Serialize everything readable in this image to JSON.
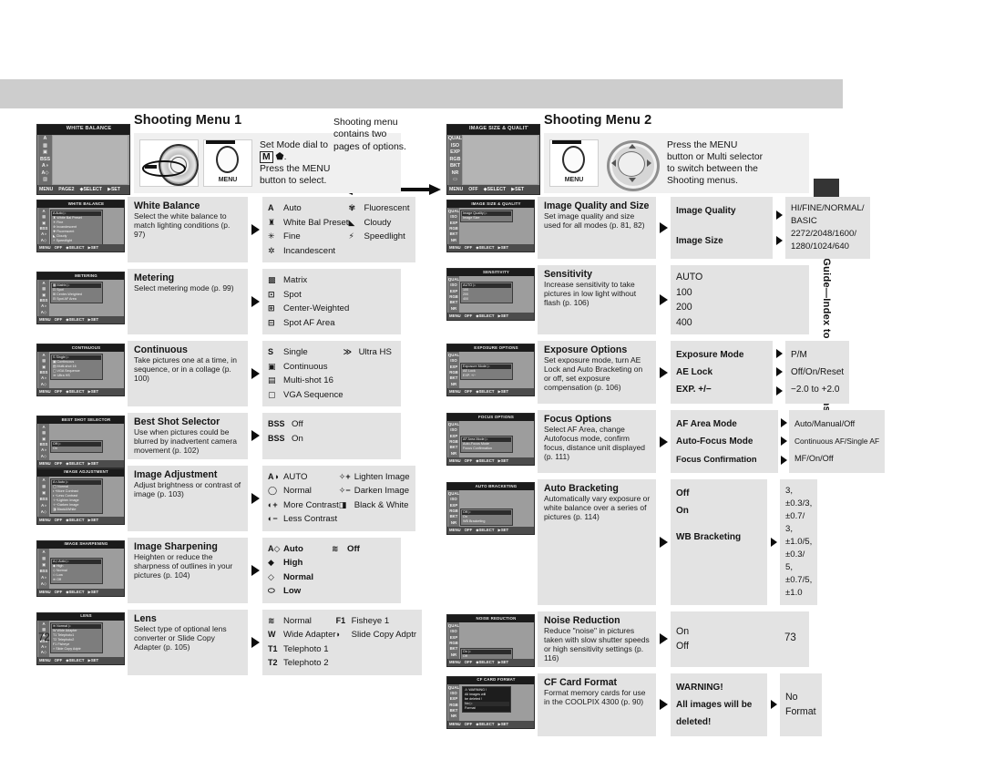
{
  "document": {
    "running_tab": "Menu Guide—Index to Menu Options",
    "page_left": "72",
    "page_right": "73"
  },
  "left_page": {
    "title": "Shooting Menu 1",
    "lcd": {
      "title": "WHITE BALANCE",
      "rail": [
        "A",
        "▩",
        "▣",
        "BSS",
        "A◑",
        "A◇",
        "▨"
      ],
      "page_marks": [
        "1",
        "2"
      ],
      "footer": [
        "MENU",
        "PAGE2",
        "◆SELECT",
        "▶ SET"
      ]
    },
    "instruction": {
      "line1": "Set Mode dial to",
      "line2": "M",
      "line3": ".",
      "line4": "Press the MENU",
      "line5": "button to select.",
      "menu_button_label": "MENU"
    },
    "side_note": "Shooting menu contains two pages of options.",
    "entries": [
      {
        "lcd_title": "WHITE BALANCE",
        "lcd_items": [
          "A  Auto",
          "White Bal Preset",
          "Fine",
          "Incandescent",
          "Fluorescent",
          "Cloudy",
          "Speedlight"
        ],
        "name": "White Balance",
        "desc": "Select the white balance to match lighting conditions (p. 97)",
        "columns": [
          [
            {
              "icon": "A",
              "label": "Auto"
            },
            {
              "icon": "♜",
              "label": "White Bal Preset"
            },
            {
              "icon": "✳",
              "label": "Fine"
            },
            {
              "icon": "✲",
              "label": "Incandescent"
            }
          ],
          [
            {
              "icon": "✾",
              "label": "Fluorescent"
            },
            {
              "icon": "◣",
              "label": "Cloudy"
            },
            {
              "icon": "⚡",
              "label": "Speedlight"
            }
          ]
        ]
      },
      {
        "lcd_title": "METERING",
        "lcd_items": [
          "Matrix",
          "Spot",
          "Center-Weighted",
          "Spot AF Area"
        ],
        "name": "Metering",
        "desc": "Select metering mode (p. 99)",
        "columns": [
          [
            {
              "icon": "▩",
              "label": "Matrix"
            },
            {
              "icon": "⊡",
              "label": "Spot"
            },
            {
              "icon": "⊞",
              "label": "Center-Weighted"
            },
            {
              "icon": "⊟",
              "label": "Spot AF Area"
            }
          ]
        ]
      },
      {
        "lcd_title": "CONTINUOUS",
        "lcd_items": [
          "Single",
          "Continuous",
          "Multi-shot 16",
          "VGA Sequence",
          "Ultra HS"
        ],
        "name": "Continuous",
        "desc": "Take pictures one at a time, in sequence, or in a collage (p. 100)",
        "columns": [
          [
            {
              "icon": "S",
              "label": "Single"
            },
            {
              "icon": "▣",
              "label": "Continuous"
            },
            {
              "icon": "▤",
              "label": "Multi-shot 16"
            },
            {
              "icon": "▢",
              "label": "VGA Sequence"
            }
          ],
          [
            {
              "icon": "≫",
              "label": "Ultra HS"
            }
          ]
        ]
      },
      {
        "lcd_title": "BEST SHOT SELECTOR",
        "lcd_items": [
          "Off",
          "On"
        ],
        "name": "Best Shot Selector",
        "desc": "Use when pictures could be blurred by inadvertent camera movement (p. 102)",
        "columns": [
          [
            {
              "icon": "BSS",
              "label": "Off"
            },
            {
              "icon": "BSS",
              "label": "On"
            }
          ]
        ]
      },
      {
        "lcd_title": "IMAGE ADJUSTMENT",
        "lcd_items": [
          "Auto",
          "Normal",
          "More Contrast",
          "Less Contrast",
          "Lighten Image",
          "Darken Image",
          "Black&White"
        ],
        "name": "Image Adjustment",
        "desc": "Adjust brightness or contrast of image (p. 103)",
        "columns": [
          [
            {
              "icon": "A◑",
              "label": "AUTO"
            },
            {
              "icon": "◯",
              "label": "Normal"
            },
            {
              "icon": "◐+",
              "label": "More Contrast"
            },
            {
              "icon": "◐−",
              "label": "Less Contrast"
            }
          ],
          [
            {
              "icon": "✧+",
              "label": "Lighten Image"
            },
            {
              "icon": "✧−",
              "label": "Darken Image"
            },
            {
              "icon": "◨",
              "label": "Black & White"
            }
          ]
        ]
      },
      {
        "lcd_title": "IMAGE SHARPENING",
        "lcd_items": [
          "Auto",
          "High",
          "Normal",
          "Low",
          "Off"
        ],
        "name": "Image Sharpening",
        "desc": "Heighten or reduce the sharpness of outlines in your pictures (p. 104)",
        "columns": [
          [
            {
              "icon": "A◇",
              "label": "Auto"
            },
            {
              "icon": "◆",
              "label": "High"
            },
            {
              "icon": "◇",
              "label": "Normal"
            },
            {
              "icon": "⬭",
              "label": "Low"
            }
          ],
          [
            {
              "icon": "≋",
              "label": "Off"
            }
          ]
        ]
      },
      {
        "lcd_title": "LENS",
        "lcd_items": [
          "Normal",
          "Wide Adapter",
          "Telephoto1",
          "Telephoto2",
          "Fisheye",
          "Slide Copy Adptr"
        ],
        "name": "Lens",
        "desc": "Select type of optional lens converter or Slide Copy Adapter (p. 105)",
        "columns": [
          [
            {
              "icon": "≋",
              "label": "Normal"
            },
            {
              "icon": "W",
              "label": "Wide Adapter"
            },
            {
              "icon": "T1",
              "label": "Telephoto 1"
            },
            {
              "icon": "T2",
              "label": "Telephoto 2"
            }
          ],
          [
            {
              "icon": "F1",
              "label": "Fisheye 1"
            },
            {
              "icon": "◗",
              "label": "Slide Copy Adptr"
            }
          ]
        ]
      }
    ]
  },
  "right_page": {
    "title": "Shooting Menu 2",
    "lcd": {
      "title": "IMAGE SIZE & QUALITY",
      "rail": [
        "QUAL",
        "ISO",
        "EXP",
        "RGB",
        "BKT",
        "NR",
        "▭"
      ],
      "page_marks": [
        "1",
        "2"
      ],
      "footer": [
        "MENU",
        "OFF",
        "◆SELECT",
        "▶ SET"
      ]
    },
    "instruction": {
      "line1": "Press the MENU",
      "line2": "button or Multi selector",
      "line3": "to switch between the",
      "line4": "Shooting menus.",
      "menu_button_label": "MENU"
    },
    "entries": [
      {
        "lcd_title": "IMAGE SIZE & QUALITY",
        "lcd_items": [
          "Image Quality",
          "Image Size"
        ],
        "name": "Image Quality and Size",
        "desc": "Set image quality and size used for all modes (p. 81, 82)",
        "pairs": [
          {
            "label": "Image Quality",
            "values": [
              "HI/FINE/NORMAL/",
              "BASIC"
            ]
          },
          {
            "label": "Image Size",
            "values": [
              "2272/2048/1600/",
              "1280/1024/640"
            ]
          }
        ]
      },
      {
        "lcd_title": "SENSITIVITY",
        "lcd_items": [
          "AUTO",
          "100",
          "200",
          "400"
        ],
        "name": "Sensitivity",
        "desc": "Increase sensitivity to take pictures in low light without flash (p. 106)",
        "options": [
          "AUTO",
          "100",
          "200",
          "400"
        ]
      },
      {
        "lcd_title": "EXPOSURE OPTIONS",
        "lcd_items": [
          "Exposure Mode",
          "AE Lock",
          "EXP. +/−"
        ],
        "name": "Exposure Options",
        "desc": "Set exposure mode, turn AE Lock and Auto Bracketing on or off, set exposure compensation (p. 106)",
        "pairs": [
          {
            "label": "Exposure Mode",
            "values": [
              "P/M"
            ]
          },
          {
            "label": "AE Lock",
            "values": [
              "Off/On/Reset"
            ]
          },
          {
            "label": "EXP. +/−",
            "values": [
              "−2.0 to +2.0"
            ]
          }
        ]
      },
      {
        "lcd_title": "FOCUS OPTIONS",
        "lcd_items": [
          "AF Area Mode",
          "Auto-Focus Mode",
          "Focus Confirmation"
        ],
        "name": "Focus Options",
        "desc": "Select AF Area, change Autofocus mode, confirm focus, distance unit displayed (p. 111)",
        "pairs": [
          {
            "label": "AF Area Mode",
            "values": [
              "Auto/Manual/Off"
            ]
          },
          {
            "label": "Auto-Focus Mode",
            "values": [
              "Continuous AF/Single AF"
            ]
          },
          {
            "label": "Focus Confirmation",
            "values": [
              "MF/On/Off"
            ]
          }
        ]
      },
      {
        "lcd_title": "AUTO BRACKETING",
        "lcd_items": [
          "Off",
          "On",
          "WB Bracketing"
        ],
        "name": "Auto Bracketing",
        "desc": "Automatically vary exposure or white balance over a series of pictures (p. 114)",
        "options": [
          "Off",
          "On",
          "WB Bracketing"
        ],
        "sub_values": [
          "3, ±0.3/3, ±0.7/",
          "3, ±1.0/5, ±0.3/",
          "5, ±0.7/5, ±1.0"
        ]
      },
      {
        "lcd_title": "NOISE REDUCTION",
        "lcd_items": [
          "On",
          "Off"
        ],
        "name": "Noise Reduction",
        "desc": "Reduce \"noise\" in pictures taken with slow shutter speeds or high sensitivity settings (p. 116)",
        "options": [
          "On",
          "Off"
        ]
      },
      {
        "lcd_title": "CF CARD FORMAT",
        "lcd_items": [
          "WARNING!",
          "All images will be deleted!",
          "No",
          "Format"
        ],
        "name": "CF Card Format",
        "desc": "Format memory cards for use in the COOLPIX 4300 (p. 90)",
        "options": [
          "WARNING!",
          "All images will be",
          "deleted!"
        ],
        "sub_values": [
          "No",
          "Format"
        ]
      }
    ]
  }
}
